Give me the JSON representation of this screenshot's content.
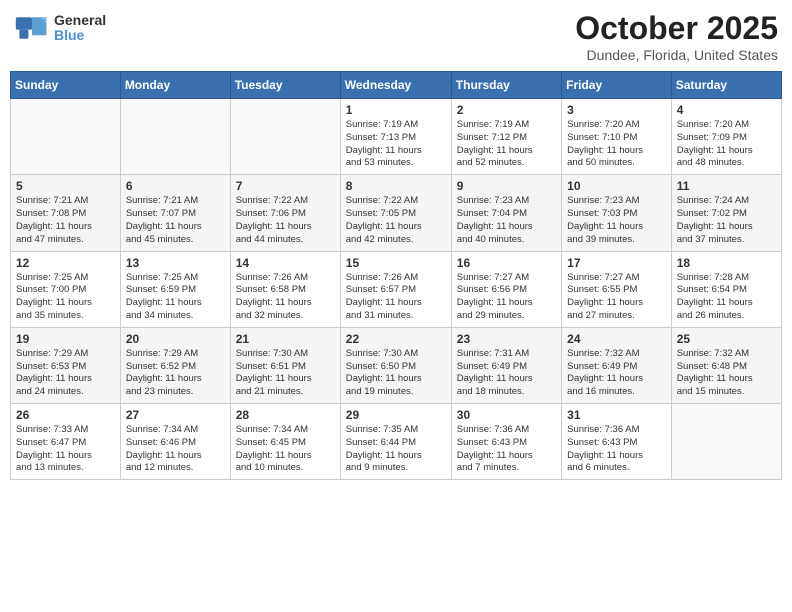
{
  "header": {
    "logo_text_line1": "General",
    "logo_text_line2": "Blue",
    "month": "October 2025",
    "location": "Dundee, Florida, United States"
  },
  "weekdays": [
    "Sunday",
    "Monday",
    "Tuesday",
    "Wednesday",
    "Thursday",
    "Friday",
    "Saturday"
  ],
  "weeks": [
    [
      {
        "num": "",
        "info": ""
      },
      {
        "num": "",
        "info": ""
      },
      {
        "num": "",
        "info": ""
      },
      {
        "num": "1",
        "info": "Sunrise: 7:19 AM\nSunset: 7:13 PM\nDaylight: 11 hours\nand 53 minutes."
      },
      {
        "num": "2",
        "info": "Sunrise: 7:19 AM\nSunset: 7:12 PM\nDaylight: 11 hours\nand 52 minutes."
      },
      {
        "num": "3",
        "info": "Sunrise: 7:20 AM\nSunset: 7:10 PM\nDaylight: 11 hours\nand 50 minutes."
      },
      {
        "num": "4",
        "info": "Sunrise: 7:20 AM\nSunset: 7:09 PM\nDaylight: 11 hours\nand 48 minutes."
      }
    ],
    [
      {
        "num": "5",
        "info": "Sunrise: 7:21 AM\nSunset: 7:08 PM\nDaylight: 11 hours\nand 47 minutes."
      },
      {
        "num": "6",
        "info": "Sunrise: 7:21 AM\nSunset: 7:07 PM\nDaylight: 11 hours\nand 45 minutes."
      },
      {
        "num": "7",
        "info": "Sunrise: 7:22 AM\nSunset: 7:06 PM\nDaylight: 11 hours\nand 44 minutes."
      },
      {
        "num": "8",
        "info": "Sunrise: 7:22 AM\nSunset: 7:05 PM\nDaylight: 11 hours\nand 42 minutes."
      },
      {
        "num": "9",
        "info": "Sunrise: 7:23 AM\nSunset: 7:04 PM\nDaylight: 11 hours\nand 40 minutes."
      },
      {
        "num": "10",
        "info": "Sunrise: 7:23 AM\nSunset: 7:03 PM\nDaylight: 11 hours\nand 39 minutes."
      },
      {
        "num": "11",
        "info": "Sunrise: 7:24 AM\nSunset: 7:02 PM\nDaylight: 11 hours\nand 37 minutes."
      }
    ],
    [
      {
        "num": "12",
        "info": "Sunrise: 7:25 AM\nSunset: 7:00 PM\nDaylight: 11 hours\nand 35 minutes."
      },
      {
        "num": "13",
        "info": "Sunrise: 7:25 AM\nSunset: 6:59 PM\nDaylight: 11 hours\nand 34 minutes."
      },
      {
        "num": "14",
        "info": "Sunrise: 7:26 AM\nSunset: 6:58 PM\nDaylight: 11 hours\nand 32 minutes."
      },
      {
        "num": "15",
        "info": "Sunrise: 7:26 AM\nSunset: 6:57 PM\nDaylight: 11 hours\nand 31 minutes."
      },
      {
        "num": "16",
        "info": "Sunrise: 7:27 AM\nSunset: 6:56 PM\nDaylight: 11 hours\nand 29 minutes."
      },
      {
        "num": "17",
        "info": "Sunrise: 7:27 AM\nSunset: 6:55 PM\nDaylight: 11 hours\nand 27 minutes."
      },
      {
        "num": "18",
        "info": "Sunrise: 7:28 AM\nSunset: 6:54 PM\nDaylight: 11 hours\nand 26 minutes."
      }
    ],
    [
      {
        "num": "19",
        "info": "Sunrise: 7:29 AM\nSunset: 6:53 PM\nDaylight: 11 hours\nand 24 minutes."
      },
      {
        "num": "20",
        "info": "Sunrise: 7:29 AM\nSunset: 6:52 PM\nDaylight: 11 hours\nand 23 minutes."
      },
      {
        "num": "21",
        "info": "Sunrise: 7:30 AM\nSunset: 6:51 PM\nDaylight: 11 hours\nand 21 minutes."
      },
      {
        "num": "22",
        "info": "Sunrise: 7:30 AM\nSunset: 6:50 PM\nDaylight: 11 hours\nand 19 minutes."
      },
      {
        "num": "23",
        "info": "Sunrise: 7:31 AM\nSunset: 6:49 PM\nDaylight: 11 hours\nand 18 minutes."
      },
      {
        "num": "24",
        "info": "Sunrise: 7:32 AM\nSunset: 6:49 PM\nDaylight: 11 hours\nand 16 minutes."
      },
      {
        "num": "25",
        "info": "Sunrise: 7:32 AM\nSunset: 6:48 PM\nDaylight: 11 hours\nand 15 minutes."
      }
    ],
    [
      {
        "num": "26",
        "info": "Sunrise: 7:33 AM\nSunset: 6:47 PM\nDaylight: 11 hours\nand 13 minutes."
      },
      {
        "num": "27",
        "info": "Sunrise: 7:34 AM\nSunset: 6:46 PM\nDaylight: 11 hours\nand 12 minutes."
      },
      {
        "num": "28",
        "info": "Sunrise: 7:34 AM\nSunset: 6:45 PM\nDaylight: 11 hours\nand 10 minutes."
      },
      {
        "num": "29",
        "info": "Sunrise: 7:35 AM\nSunset: 6:44 PM\nDaylight: 11 hours\nand 9 minutes."
      },
      {
        "num": "30",
        "info": "Sunrise: 7:36 AM\nSunset: 6:43 PM\nDaylight: 11 hours\nand 7 minutes."
      },
      {
        "num": "31",
        "info": "Sunrise: 7:36 AM\nSunset: 6:43 PM\nDaylight: 11 hours\nand 6 minutes."
      },
      {
        "num": "",
        "info": ""
      }
    ]
  ]
}
